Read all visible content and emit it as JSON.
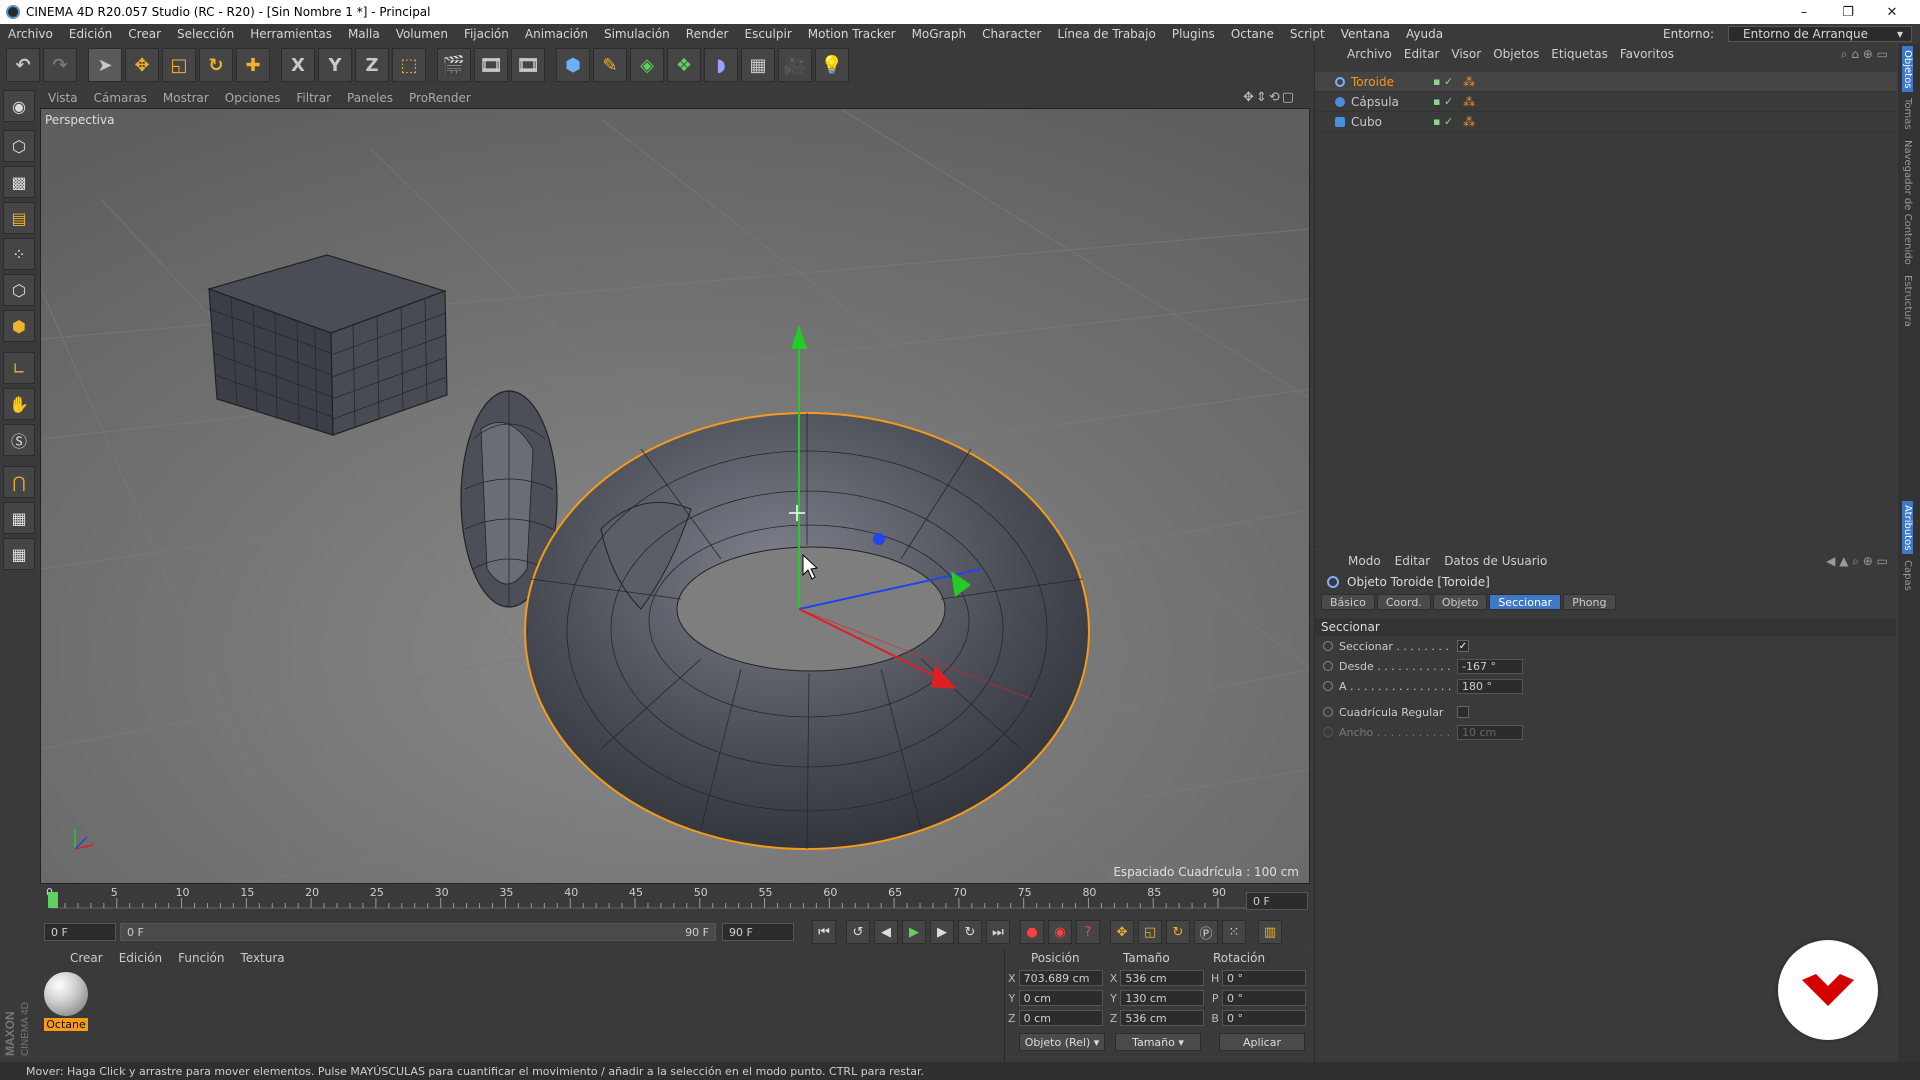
{
  "window": {
    "title": "CINEMA 4D R20.057 Studio (RC - R20) - [Sin Nombre 1 *] - Principal",
    "controls": [
      "–",
      "❐",
      "✕"
    ]
  },
  "menubar": {
    "items": [
      "Archivo",
      "Edición",
      "Crear",
      "Selección",
      "Herramientas",
      "Malla",
      "Volumen",
      "Fijación",
      "Animación",
      "Simulación",
      "Render",
      "Esculpir",
      "Motion Tracker",
      "MoGraph",
      "Character",
      "Línea de Trabajo",
      "Plugins",
      "Octane",
      "Script",
      "Ventana",
      "Ayuda"
    ],
    "env_label": "Entorno:",
    "env_value": "Entorno de Arranque"
  },
  "toolbar": {
    "axis_x": "X",
    "axis_y": "Y",
    "axis_z": "Z"
  },
  "viewport": {
    "menu": [
      "Vista",
      "Cámaras",
      "Mostrar",
      "Opciones",
      "Filtrar",
      "Paneles",
      "ProRender"
    ],
    "label": "Perspectiva",
    "grid_info": "Espaciado Cuadrícula : 100 cm"
  },
  "timeline": {
    "ticks": [
      "0",
      "5",
      "10",
      "15",
      "20",
      "25",
      "30",
      "35",
      "40",
      "45",
      "50",
      "55",
      "60",
      "65",
      "70",
      "75",
      "80",
      "85",
      "90"
    ],
    "current_frame": "0 F",
    "start_frame": "0 F",
    "range_start": "0 F",
    "range_end": "90 F",
    "end_frame": "90 F"
  },
  "materials": {
    "menu": [
      "Crear",
      "Edición",
      "Función",
      "Textura"
    ],
    "items": [
      {
        "name": "Octane"
      }
    ]
  },
  "coordinates": {
    "headers": [
      "Posición",
      "Tamaño",
      "Rotación"
    ],
    "rows": [
      {
        "axis": "X",
        "pos": "703.689 cm",
        "size_axis": "X",
        "size": "536 cm",
        "rot_axis": "H",
        "rot": "0 °"
      },
      {
        "axis": "Y",
        "pos": "0 cm",
        "size_axis": "Y",
        "size": "130 cm",
        "rot_axis": "P",
        "rot": "0 °"
      },
      {
        "axis": "Z",
        "pos": "0 cm",
        "size_axis": "Z",
        "size": "536 cm",
        "rot_axis": "B",
        "rot": "0 °"
      }
    ],
    "mode": "Objeto (Rel)",
    "size_mode": "Tamaño",
    "apply": "Aplicar"
  },
  "object_manager": {
    "menu": [
      "Archivo",
      "Editar",
      "Visor",
      "Objetos",
      "Etiquetas",
      "Favoritos"
    ],
    "objects": [
      {
        "name": "Toroide",
        "color": "#f59a1a",
        "selected": true
      },
      {
        "name": "Cápsula",
        "color": "#4b8fe0",
        "selected": false
      },
      {
        "name": "Cubo",
        "color": "#4b8fe0",
        "selected": false
      }
    ]
  },
  "attribute_manager": {
    "menu": [
      "Modo",
      "Editar",
      "Datos de Usuario"
    ],
    "title": "Objeto Toroide [Toroide]",
    "tabs": [
      "Básico",
      "Coord.",
      "Objeto",
      "Seccionar",
      "Phong"
    ],
    "active_tab": "Seccionar",
    "section": "Seccionar",
    "params": {
      "seccionar_label": "Seccionar . . . . . . . .",
      "seccionar_check": "✓",
      "desde_label": "Desde . . . . . . . . . . .",
      "desde_value": "-167 °",
      "a_label": "A . . . . . . . . . . . . . . .",
      "a_value": "180 °",
      "cuadricula_label": "Cuadrícula Regular",
      "ancho_label": "Ancho . . . . . . . . . . .",
      "ancho_value": "10 cm"
    }
  },
  "right_tabs": [
    "Objetos",
    "Tomas",
    "Navegador de Contenido",
    "Estructura",
    "Atributos",
    "Capas"
  ],
  "statusbar": {
    "text": "Mover: Haga Click y arrastre para mover elementos. Pulse MAYÚSCULAS para cuantificar el movimiento / añadir a la selección en el modo punto. CTRL para restar."
  },
  "brand": {
    "maxon": "MAXON",
    "cinema": "CINEMA 4D"
  },
  "colors": {
    "selection_orange": "#f59a1a",
    "accent_blue": "#3f78c6",
    "axis_x": "#e02020",
    "axis_y": "#22cc22",
    "axis_z": "#2244ee",
    "badge_red": "#d40000"
  }
}
